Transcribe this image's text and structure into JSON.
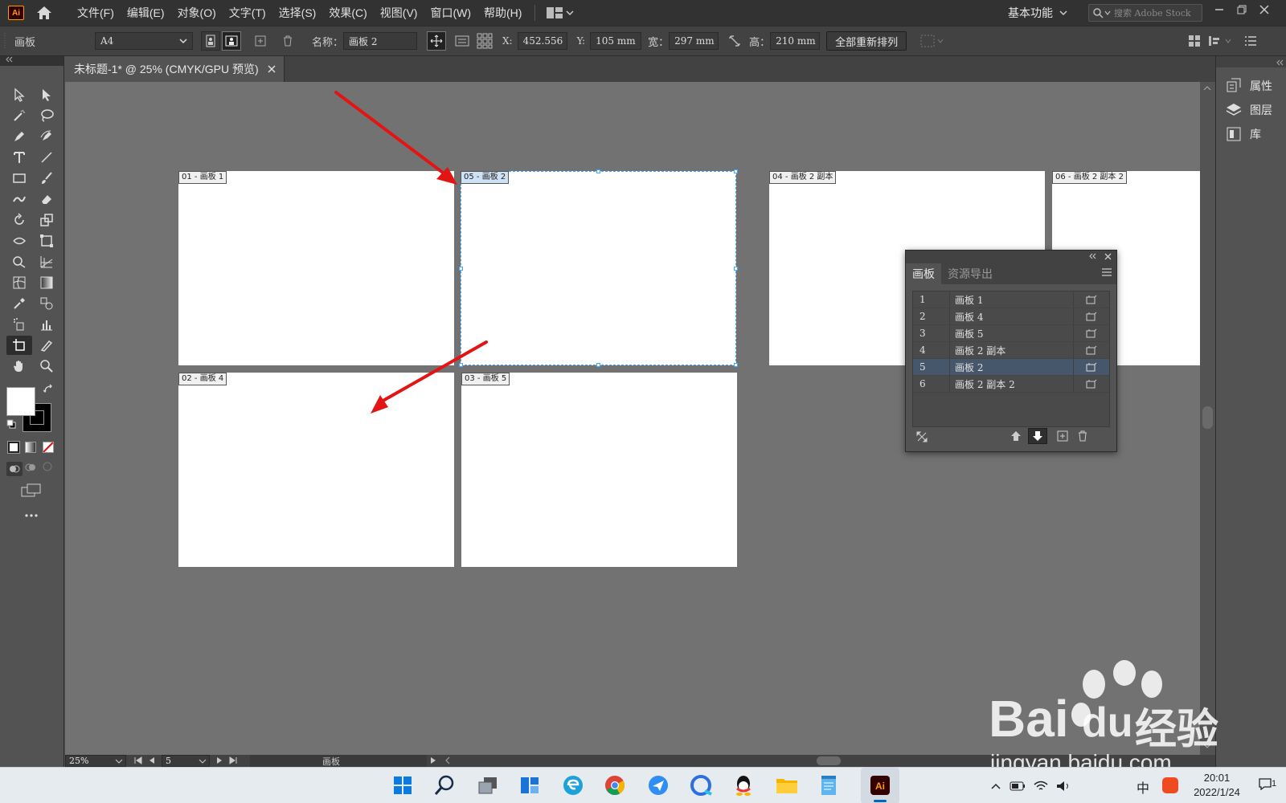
{
  "menubar": {
    "logo": "Ai",
    "items": [
      "文件(F)",
      "编辑(E)",
      "对象(O)",
      "文字(T)",
      "选择(S)",
      "效果(C)",
      "视图(V)",
      "窗口(W)",
      "帮助(H)"
    ],
    "workspace": "基本功能",
    "search_placeholder": "搜索 Adobe Stock"
  },
  "controlbar": {
    "mode_label": "画板",
    "preset": "A4",
    "name_label": "名称：",
    "name_value": "画板 2",
    "x_label": "X:",
    "x_value": "452.556",
    "y_label": "Y:",
    "y_value": "105 mm",
    "w_label": "宽：",
    "w_value": "297 mm",
    "h_label": "高：",
    "h_value": "210 mm",
    "rearrange_button": "全部重新排列"
  },
  "document": {
    "tab_title": "未标题-1* @ 25% (CMYK/GPU 预览)"
  },
  "artboards": [
    {
      "label": "01 - 画板 1"
    },
    {
      "label": "05 - 画板 2"
    },
    {
      "label": "04 - 画板 2 副本"
    },
    {
      "label": "06 - 画板 2 副本 2"
    },
    {
      "label": "02 - 画板 4"
    },
    {
      "label": "03 - 画板 5"
    }
  ],
  "right_panel": {
    "items": [
      "属性",
      "图层",
      "库"
    ]
  },
  "artboard_panel": {
    "tabs": [
      "画板",
      "资源导出"
    ],
    "rows": [
      {
        "num": "1",
        "name": "画板 1"
      },
      {
        "num": "2",
        "name": "画板 4"
      },
      {
        "num": "3",
        "name": "画板 5"
      },
      {
        "num": "4",
        "name": "画板 2 副本"
      },
      {
        "num": "5",
        "name": "画板 2"
      },
      {
        "num": "6",
        "name": "画板 2 副本 2"
      }
    ],
    "selected_row": "5"
  },
  "statusbar": {
    "zoom": "25%",
    "artboard_num": "5",
    "tool_name": "画板"
  },
  "taskbar": {
    "ime": "中",
    "time": "20:01",
    "date": "2022/1/24",
    "notification_count": "1"
  },
  "watermark": {
    "brand": "Bai",
    "brand2": "du",
    "cn": "经验",
    "url": "jingyan.baidu.com"
  },
  "colors": {
    "selection_blue": "#3ea6ff",
    "annotation_arrow": "#e31414",
    "panel_selected_row": "#46566b"
  }
}
